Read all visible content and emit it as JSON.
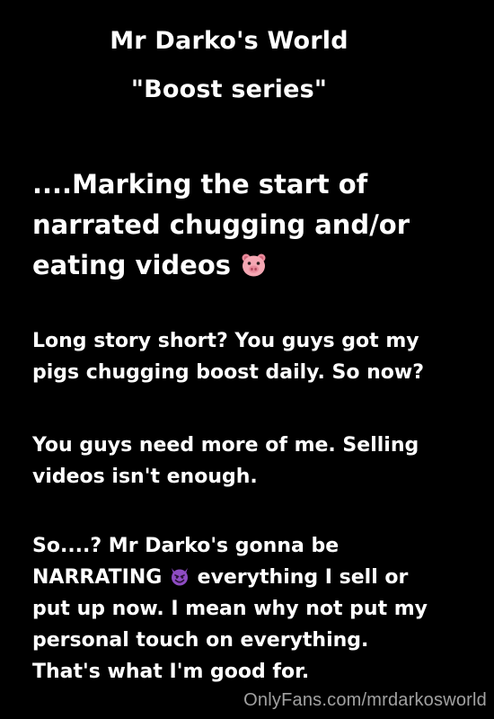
{
  "title": {
    "line1": "Mr Darko's World",
    "line2": "\"Boost series\""
  },
  "heading": {
    "line1": " ....Marking the start of",
    "line2": "narrated chugging and/or",
    "line3": "eating videos",
    "emoji": "pig-face-icon"
  },
  "paragraph1": {
    "line1": "Long story short? You guys got my",
    "line2": "pigs chugging boost daily. So now?"
  },
  "paragraph2": {
    "line1": "You guys need more of me. Selling",
    "line2": "videos isn't enough."
  },
  "paragraph3": {
    "line1": "So....? Mr Darko's gonna be",
    "line2_before": "NARRATING",
    "line2_after": " everything I sell or",
    "line3": "put up now. I mean why not put my",
    "line4": "personal touch on everything.",
    "line5": "That's what I'm good for.",
    "emoji": "smiling-devil-icon"
  },
  "watermark": "OnlyFans.com/mrdarkosworld",
  "colors": {
    "background": "#000000",
    "text": "#ffffff",
    "watermark": "#d7d7d7",
    "pig_pink": "#f4a7b3",
    "devil_purple": "#8e4cc3"
  }
}
